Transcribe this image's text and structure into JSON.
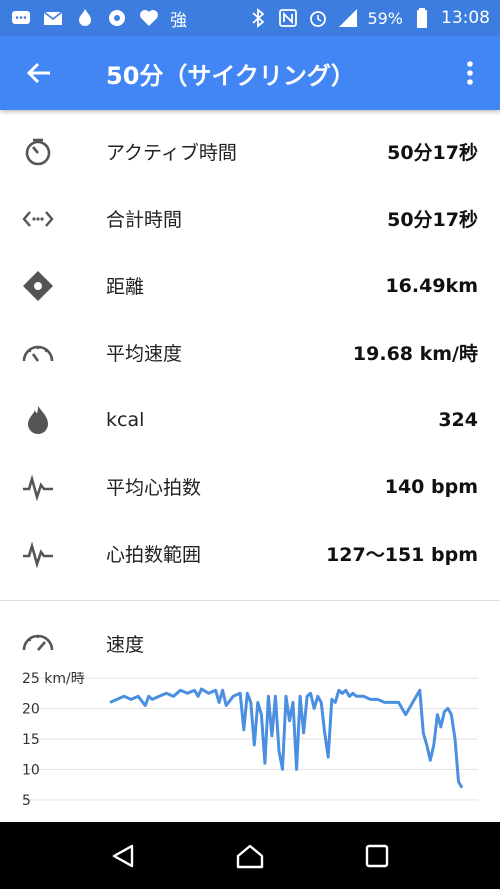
{
  "status_bar": {
    "battery": "59%",
    "time": "13:08",
    "kanji": "強",
    "icons": [
      "message-icon",
      "mail-icon",
      "flame-icon",
      "app-icon",
      "heart-icon",
      "bluetooth-icon",
      "nfc-icon",
      "alarm-icon",
      "signal-icon",
      "battery-icon"
    ]
  },
  "header": {
    "title": "50分（サイクリング）"
  },
  "stats": [
    {
      "icon": "timer-icon",
      "label": "アクティブ時間",
      "value": "50分17秒"
    },
    {
      "icon": "code-arrows-icon",
      "label": "合計時間",
      "value": "50分17秒"
    },
    {
      "icon": "location-diamond-icon",
      "label": "距離",
      "value": "16.49km"
    },
    {
      "icon": "speedometer-icon",
      "label": "平均速度",
      "value": "19.68 km/時"
    },
    {
      "icon": "flame-icon",
      "label": "kcal",
      "value": "324"
    },
    {
      "icon": "heart-rate-icon",
      "label": "平均心拍数",
      "value": "140 bpm"
    },
    {
      "icon": "heart-rate-icon",
      "label": "心拍数範囲",
      "value": "127〜151 bpm"
    }
  ],
  "speed_section": {
    "icon": "speedometer-icon",
    "label": "速度"
  },
  "chart_data": {
    "type": "line",
    "ylabel": "",
    "ytick_labels": [
      "25 km/時",
      "20",
      "15",
      "10",
      "5"
    ],
    "yticks": [
      25,
      20,
      15,
      10,
      5
    ],
    "ylim": [
      3,
      26
    ],
    "xlim": [
      0,
      100
    ],
    "color": "#4a8fe0",
    "series": [
      {
        "x": [
          0,
          2,
          4,
          6,
          8,
          10,
          11,
          12,
          14,
          16,
          18,
          20,
          22,
          24,
          25,
          26,
          28,
          30,
          31,
          32,
          33,
          35,
          37,
          38,
          39,
          40,
          41,
          42,
          43,
          44,
          45,
          46,
          47,
          48,
          49,
          50,
          51,
          52,
          53,
          54,
          55,
          56,
          57,
          58,
          59,
          60,
          61,
          62,
          63,
          64,
          65,
          66,
          67,
          68,
          69,
          70,
          72,
          74,
          76,
          78,
          80,
          82,
          84,
          86,
          88,
          89,
          90,
          91,
          92,
          93,
          94,
          95,
          96,
          97,
          98,
          99,
          100
        ],
        "values": [
          21,
          21.5,
          22,
          21.5,
          22,
          20.5,
          22,
          21.5,
          22,
          22.5,
          22,
          23,
          22.5,
          23,
          22,
          23.2,
          22.5,
          23,
          21,
          23,
          20.5,
          22,
          22.5,
          16.5,
          22.5,
          21,
          14,
          21,
          19,
          11,
          22,
          15.5,
          22,
          13,
          10,
          22,
          18,
          21,
          10,
          22,
          16,
          22,
          22.5,
          20,
          22,
          21,
          16,
          12,
          21.5,
          21,
          23,
          22.5,
          23,
          22,
          22.5,
          22,
          22,
          21.5,
          21.5,
          21,
          21,
          21,
          19,
          21,
          23,
          16,
          14,
          11.5,
          14,
          19,
          17,
          19.5,
          20,
          19,
          15,
          8,
          7
        ]
      }
    ]
  }
}
